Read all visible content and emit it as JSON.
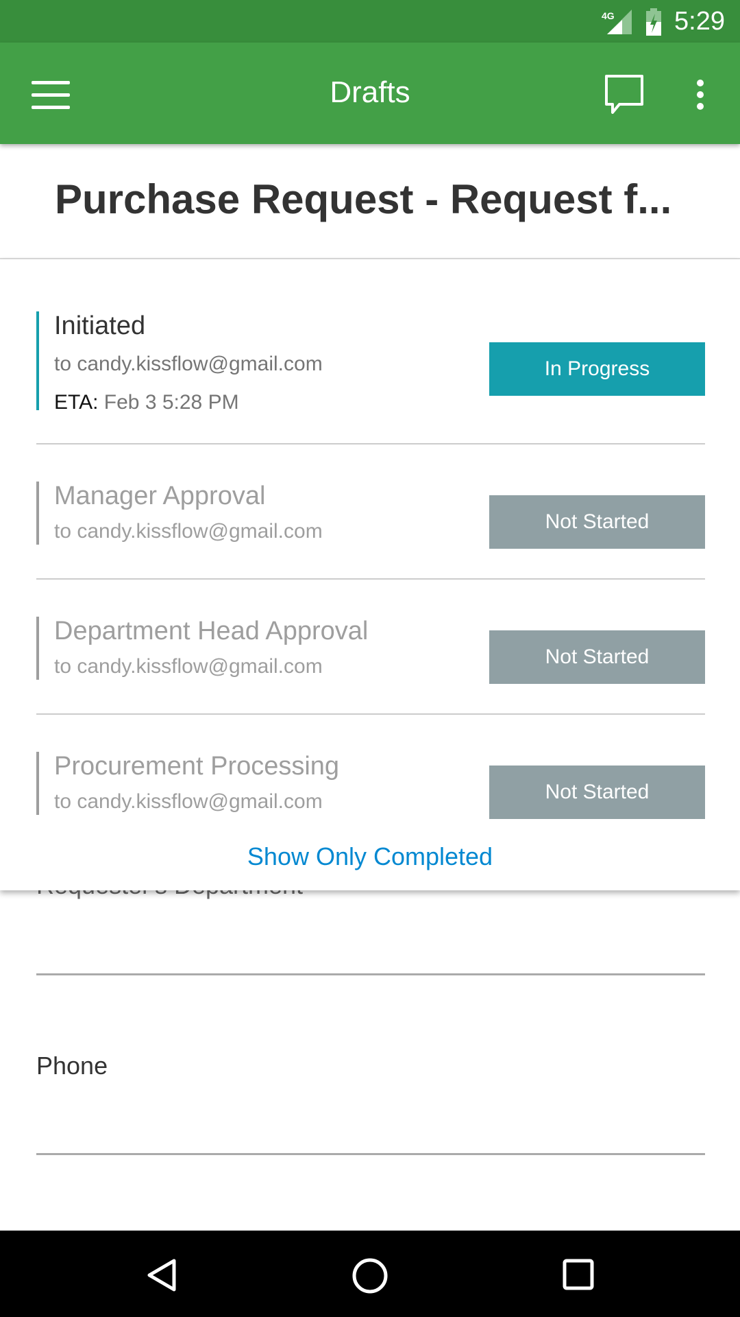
{
  "status_bar": {
    "network": "4G",
    "time": "5:29",
    "icons": [
      "signal-icon",
      "battery-charging-icon"
    ]
  },
  "app_bar": {
    "title": "Drafts",
    "icons": [
      "menu-icon",
      "comment-icon",
      "more-vert-icon"
    ]
  },
  "page_title": "Purchase Request - Request f...",
  "workflow": {
    "steps": [
      {
        "title": "Initiated",
        "assignee": "to candy.kissflow@gmail.com",
        "eta_label": "ETA:",
        "eta": "Feb 3 5:28 PM",
        "status": "In Progress",
        "status_color": "#169fad"
      },
      {
        "title": "Manager Approval",
        "assignee": "to candy.kissflow@gmail.com",
        "status": "Not Started",
        "status_color": "#90a0a4"
      },
      {
        "title": "Department Head Approval",
        "assignee": "to candy.kissflow@gmail.com",
        "status": "Not Started",
        "status_color": "#90a0a4"
      },
      {
        "title": "Procurement Processing",
        "assignee": "to candy.kissflow@gmail.com",
        "status": "Not Started",
        "status_color": "#90a0a4"
      }
    ],
    "toggle_label": "Show Only Completed"
  },
  "form": {
    "fields": [
      {
        "label": "Requester's Department"
      },
      {
        "label": "Phone"
      }
    ]
  },
  "colors": {
    "status_bar": "#388e3c",
    "app_bar": "#43a047",
    "link": "#0288d1"
  }
}
